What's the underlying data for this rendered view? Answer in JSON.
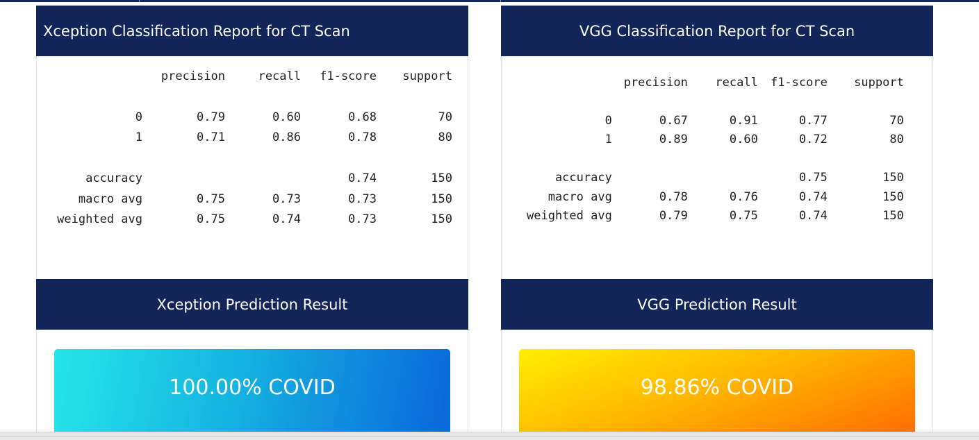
{
  "left": {
    "report_title": "Xception Classification Report for CT Scan",
    "prediction_title": "Xception Prediction Result",
    "result_text": "100.00% COVID",
    "table": {
      "headers": [
        "",
        "precision",
        "recall",
        "f1-score",
        "support"
      ],
      "class_rows": [
        [
          "0",
          "0.79",
          "0.60",
          "0.68",
          "70"
        ],
        [
          "1",
          "0.71",
          "0.86",
          "0.78",
          "80"
        ]
      ],
      "summary_rows": [
        [
          "accuracy",
          "",
          "",
          "0.74",
          "150"
        ],
        [
          "macro avg",
          "0.75",
          "0.73",
          "0.73",
          "150"
        ],
        [
          "weighted avg",
          "0.75",
          "0.74",
          "0.73",
          "150"
        ]
      ]
    }
  },
  "right": {
    "report_title": "VGG Classification Report for CT Scan",
    "prediction_title": "VGG Prediction Result",
    "result_text": "98.86% COVID",
    "table": {
      "headers": [
        "",
        "precision",
        "recall",
        "f1-score",
        "support"
      ],
      "class_rows": [
        [
          "0",
          "0.67",
          "0.91",
          "0.77",
          "70"
        ],
        [
          "1",
          "0.89",
          "0.60",
          "0.72",
          "80"
        ]
      ],
      "summary_rows": [
        [
          "accuracy",
          "",
          "",
          "0.75",
          "150"
        ],
        [
          "macro avg",
          "0.78",
          "0.76",
          "0.74",
          "150"
        ],
        [
          "weighted avg",
          "0.79",
          "0.75",
          "0.74",
          "150"
        ]
      ]
    }
  },
  "colors": {
    "header_bg": "#13265a",
    "xception_gradient": [
      "#25e6e8",
      "#0a66db"
    ],
    "vgg_gradient": [
      "#ffef00",
      "#ff6a00"
    ]
  }
}
